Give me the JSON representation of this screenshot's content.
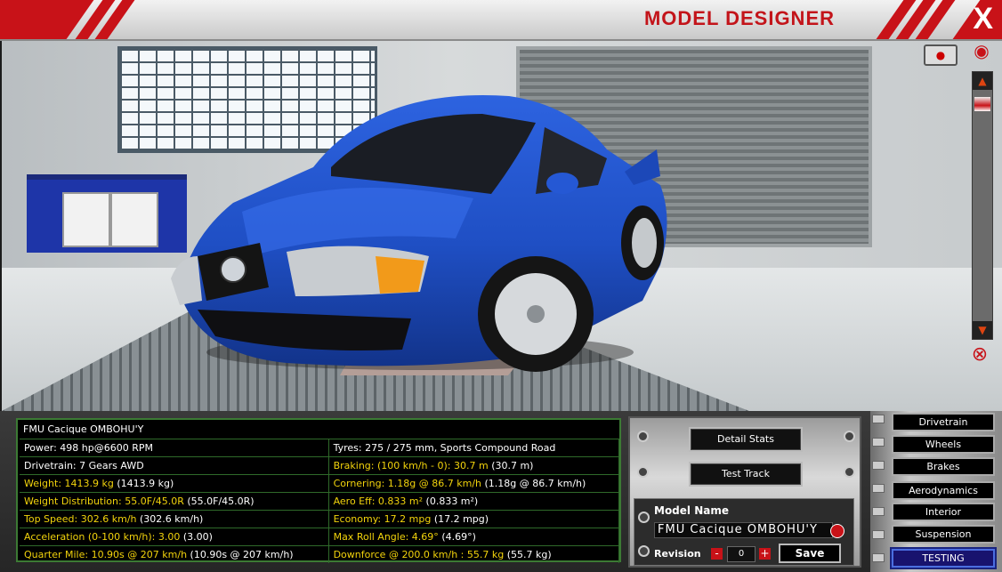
{
  "header": {
    "title": "MODEL DESIGNER",
    "close_label": "X"
  },
  "viewport": {
    "camera_icon": "camera-icon",
    "eye_icon": "eye-icon",
    "scroll_up_icon": "arrow-up-icon",
    "scroll_down_icon": "arrow-down-icon",
    "hide_icon": "eye-crossed-icon"
  },
  "stats": {
    "model_name": "FMU Cacique OMBOHU'Y",
    "rows": [
      {
        "left": "Power: 498 hp@6600 RPM",
        "right": "Tyres: 275 / 275 mm, Sports Compound Road"
      },
      {
        "left": "Drivetrain: 7 Gears AWD",
        "right": "Braking: (100 km/h - 0): 30.7 m",
        "right_paren": "(30.7 m)"
      },
      {
        "left": "Weight: 1413.9 kg",
        "left_paren": "(1413.9 kg)",
        "right": "Cornering: 1.18g @ 86.7 km/h",
        "right_paren": "(1.18g @ 86.7 km/h)"
      },
      {
        "left": "Weight Distribution: 55.0F/45.0R",
        "left_paren": "(55.0F/45.0R)",
        "right": "Aero Eff: 0.833 m²",
        "right_paren": "(0.833 m²)"
      },
      {
        "left": "Top Speed: 302.6 km/h",
        "left_paren": "(302.6 km/h)",
        "right": "Economy: 17.2 mpg",
        "right_paren": "(17.2 mpg)"
      },
      {
        "left": "Acceleration (0-100 km/h): 3.00",
        "left_paren": "(3.00)",
        "right": "Max Roll Angle: 4.69°",
        "right_paren": "(4.69°)"
      },
      {
        "left": "Quarter Mile: 10.90s @ 207 km/h",
        "left_paren": "(10.90s @ 207 km/h)",
        "right": "Downforce @ 200.0 km/h : 55.7 kg",
        "right_paren": "(55.7 kg)"
      }
    ]
  },
  "actions": {
    "detail_stats": "Detail Stats",
    "test_track": "Test Track"
  },
  "model_panel": {
    "label": "Model Name",
    "name_value": "FMU Cacique OMBOHU'Y",
    "revision_label": "Revision",
    "revision_minus": "-",
    "revision_plus": "+",
    "revision_value": "0",
    "save_label": "Save"
  },
  "categories": [
    {
      "label": "Drivetrain"
    },
    {
      "label": "Wheels"
    },
    {
      "label": "Brakes"
    },
    {
      "label": "Aerodynamics"
    },
    {
      "label": "Interior"
    },
    {
      "label": "Suspension"
    },
    {
      "label": "TESTING",
      "active": true
    }
  ],
  "colors": {
    "brand_red": "#c81218",
    "stat_yellow": "#f2d30c",
    "car_blue": "#1f4fc4",
    "active_tab": "#18136e"
  }
}
